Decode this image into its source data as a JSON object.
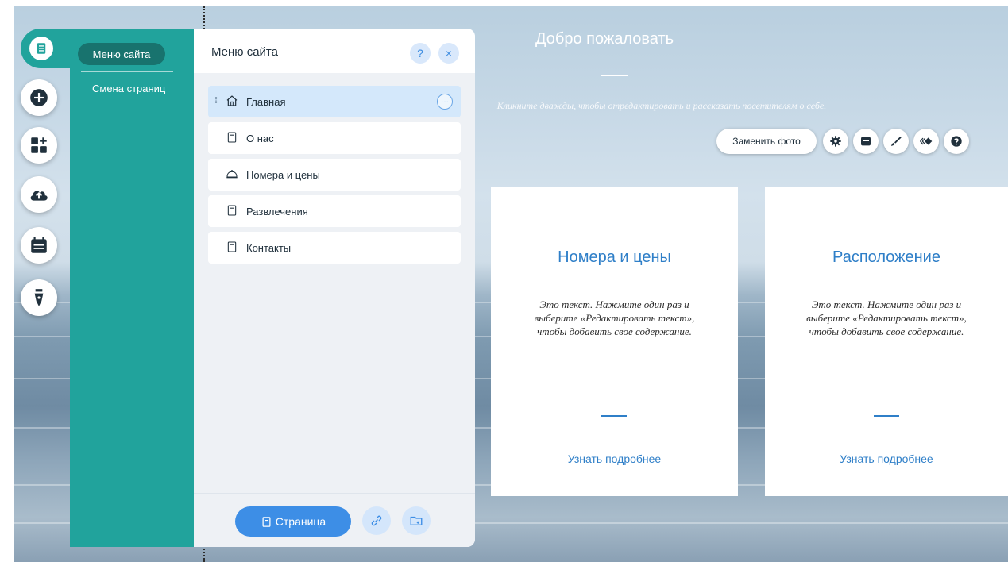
{
  "sidebar": {
    "tools": [
      {
        "name": "pages",
        "icon": "pages-icon"
      },
      {
        "name": "add",
        "icon": "plus-icon"
      },
      {
        "name": "apps",
        "icon": "add-apps-icon"
      },
      {
        "name": "upload",
        "icon": "cloud-upload-icon"
      },
      {
        "name": "bookings",
        "icon": "calendar-icon"
      },
      {
        "name": "blog",
        "icon": "pen-nib-icon"
      }
    ]
  },
  "teal_panel": {
    "tab_active": "Меню сайта",
    "tab_transitions": "Смена страниц"
  },
  "menu_panel": {
    "title": "Меню сайта",
    "help_label": "?",
    "close_label": "×",
    "pages": [
      {
        "label": "Главная",
        "icon": "home-icon",
        "selected": true
      },
      {
        "label": "О нас",
        "icon": "page-icon",
        "selected": false
      },
      {
        "label": "Номера и цены",
        "icon": "service-bell-icon",
        "selected": false
      },
      {
        "label": "Развлечения",
        "icon": "page-icon",
        "selected": false
      },
      {
        "label": "Контакты",
        "icon": "page-icon",
        "selected": false
      }
    ],
    "more_label": "···",
    "add_page_label": "Страница"
  },
  "hero": {
    "title": "Добро пожаловать",
    "text": "Кликните дважды, чтобы отредактировать и рассказать посетителям о себе."
  },
  "toolbar": {
    "replace_photo_label": "Заменить фото",
    "buttons": [
      "gear-icon",
      "layout-icon",
      "brush-icon",
      "animation-icon",
      "help-icon"
    ]
  },
  "cards": [
    {
      "title": "Номера и цены",
      "text": "Это текст. Нажмите один раз и выберите «Редактировать текст», чтобы добавить свое содержание.",
      "link": "Узнать подробнее"
    },
    {
      "title": "Расположение",
      "text": "Это текст. Нажмите один раз и выберите «Редактировать текст», чтобы добавить свое содержание.",
      "link": "Узнать подробнее"
    }
  ],
  "colors": {
    "teal": "#21a39c",
    "teal_dark": "#18736e",
    "accent_blue": "#3d8ee6",
    "link_blue": "#2f7fc8",
    "selected_row": "#d4e8fb"
  }
}
